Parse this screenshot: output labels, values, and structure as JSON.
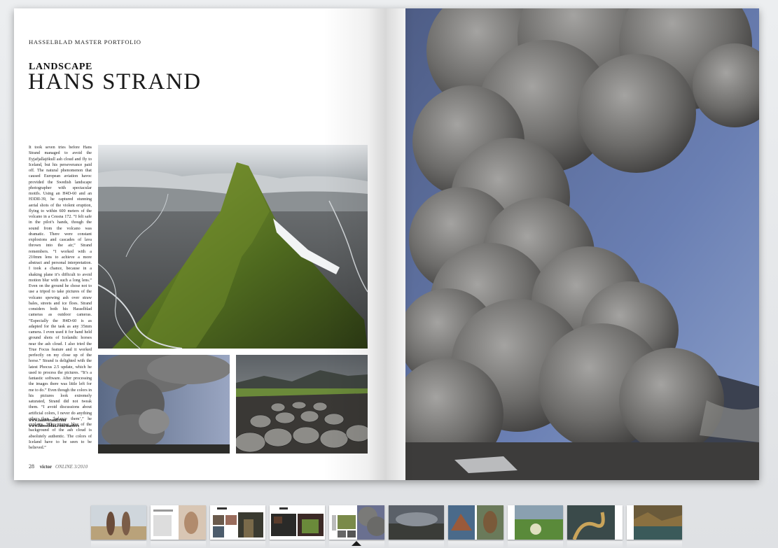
{
  "viewer": {
    "name": "magazine-spread-viewer"
  },
  "left_page": {
    "kicker": "HASSELBLAD MASTER PORTFOLIO",
    "section": "LANDSCAPE",
    "author": "HANS STRAND",
    "body": "It took seven tries before Hans Strand managed to avoid the Eyjafjallajökull ash cloud and fly to Iceland, but his perseverance paid off. The natural phenomenon that caused European aviation havoc provided the Swedish landscape photographer with spectacular motifs. Using an H4D-60 and an H3DII-39, he captured stunning aerial shots of the violent eruption, flying to within 600 meters of the volcano in a Cessna 172. “I felt safe in the pilot’s hands, though the sound from the volcano was dramatic. There were constant explosions and cascades of lava thrown into the air,” Strand remembers. “I worked with a 210mm lens to achieve a more abstract and personal interpretation. I took a chance, because in a shaking plane it’s difficult to avoid motion blur with such a long lens.” Even on the ground he chose not to use a tripod to take pictures of the volcano spewing ash over straw bales, streets and ice floes. Strand considers both his Hasselblad cameras as outdoor cameras. “Especially the H4D-60 is as adapted for the task as any 35mm camera. I even used it for hand held ground shots of Icelandic horses near the ash cloud. I also tried the True Focus feature and it worked perfectly on my close up of the horse.” Strand is delighted with the latest Phocus 2.5 update, which he used to process the pictures. “It’s a fantastic software. After processing the images there was little left for me to do.” Even though the colors in his pictures look extremely saturated, Strand did not tweak them. “I avoid discussions about artificial colors, I never do anything other than ‘balance them’,” he explains. “The intense blue of the background of the ash cloud is absolutely authentic. The colors of Iceland have to be seen to be believed.”",
    "link1": "www.hansstrand.com",
    "link2": "www.hasselblad.com/masters",
    "page_number": "28",
    "brand": "victor",
    "issue": "ONLINE 3/2010"
  },
  "thumbnails": [
    {
      "label": "spread-1"
    },
    {
      "label": "spread-2"
    },
    {
      "label": "spread-3"
    },
    {
      "label": "spread-4"
    },
    {
      "label": "spread-5"
    },
    {
      "label": "spread-6"
    },
    {
      "label": "spread-7"
    },
    {
      "label": "spread-8"
    },
    {
      "label": "spread-9"
    },
    {
      "label": "spread-10"
    }
  ],
  "current_thumbnail": 5,
  "colors": {
    "viewer_bg": "#e9eaec",
    "marker": "#1b1b1b",
    "page": "#ffffff"
  }
}
